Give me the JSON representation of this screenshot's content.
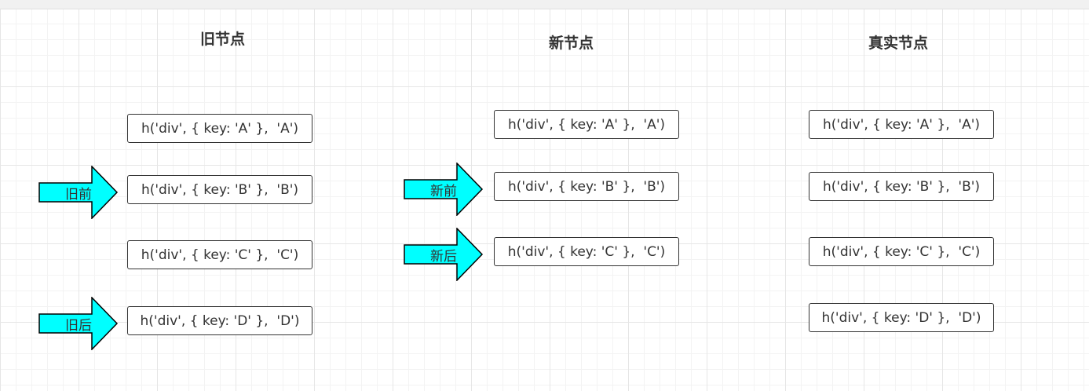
{
  "columns": {
    "old": {
      "title": "旧节点",
      "nodes": [
        "h('div', { key: 'A' },  'A')",
        "h('div', { key: 'B' },  'B')",
        "h('div', { key: 'C' },  'C')",
        "h('div', { key: 'D' },  'D')"
      ]
    },
    "new": {
      "title": "新节点",
      "nodes": [
        "h('div', { key: 'A' },  'A')",
        "h('div', { key: 'B' },  'B')",
        "h('div', { key: 'C' },  'C')"
      ]
    },
    "real": {
      "title": "真实节点",
      "nodes": [
        "h('div', { key: 'A' },  'A')",
        "h('div', { key: 'B' },  'B')",
        "h('div', { key: 'C' },  'C')",
        "h('div', { key: 'D' },  'D')"
      ]
    }
  },
  "pointers": {
    "old_start": "旧前",
    "old_end": "旧后",
    "new_start": "新前",
    "new_end": "新后"
  },
  "colors": {
    "arrow_fill": "#00ffff",
    "arrow_stroke": "#000000",
    "box_border": "#333333",
    "text": "#333333"
  }
}
